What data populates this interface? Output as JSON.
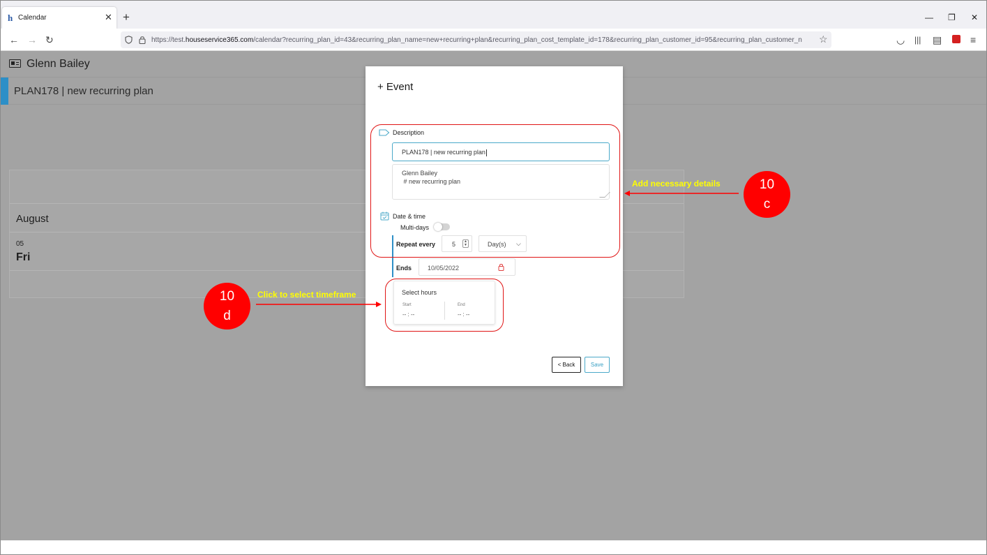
{
  "browser": {
    "tab_title": "Calendar",
    "favicon": "h",
    "new_tab": "+",
    "url_prefix": "https://test.",
    "url_domain": "houseservice365.com",
    "url_rest": "/calendar?recurring_plan_id=43&recurring_plan_name=new+recurring+plan&recurring_plan_cost_template_id=178&recurring_plan_customer_id=95&recurring_plan_customer_n"
  },
  "page": {
    "customer_name": "Glenn Bailey",
    "plan_title": "PLAN178 | new recurring plan",
    "calendar": {
      "month": "August",
      "day_number": "05",
      "day_name": "Fri"
    }
  },
  "modal": {
    "title": "+ Event",
    "description_label": "Description",
    "description_value": "PLAN178 | new recurring plan",
    "notes_line1": "Glenn Bailey",
    "notes_line2": " # new recurring plan",
    "date_time_label": "Date & time",
    "multi_days_label": "Multi-days",
    "multi_days_enabled": false,
    "repeat_label": "Repeat every",
    "repeat_value": "5",
    "repeat_unit": "Day(s)",
    "ends_label": "Ends",
    "ends_value": "10/05/2022",
    "hours": {
      "title": "Select hours",
      "start_label": "Start",
      "start_value": "-- : --",
      "end_label": "End",
      "end_value": "-- : --"
    },
    "back_label": "< Back",
    "save_label": "Save"
  },
  "annotations": {
    "step_c_number": "10",
    "step_c_letter": "c",
    "step_c_text": "Add necessary details",
    "step_d_number": "10",
    "step_d_letter": "d",
    "step_d_text": "Click to select timeframe",
    "color": "#ff0000",
    "text_color": "#ffff00"
  },
  "colors": {
    "accent": "#2d8fc7",
    "input_focus": "#4ba9c9",
    "overlay": "#a3a3a3"
  }
}
